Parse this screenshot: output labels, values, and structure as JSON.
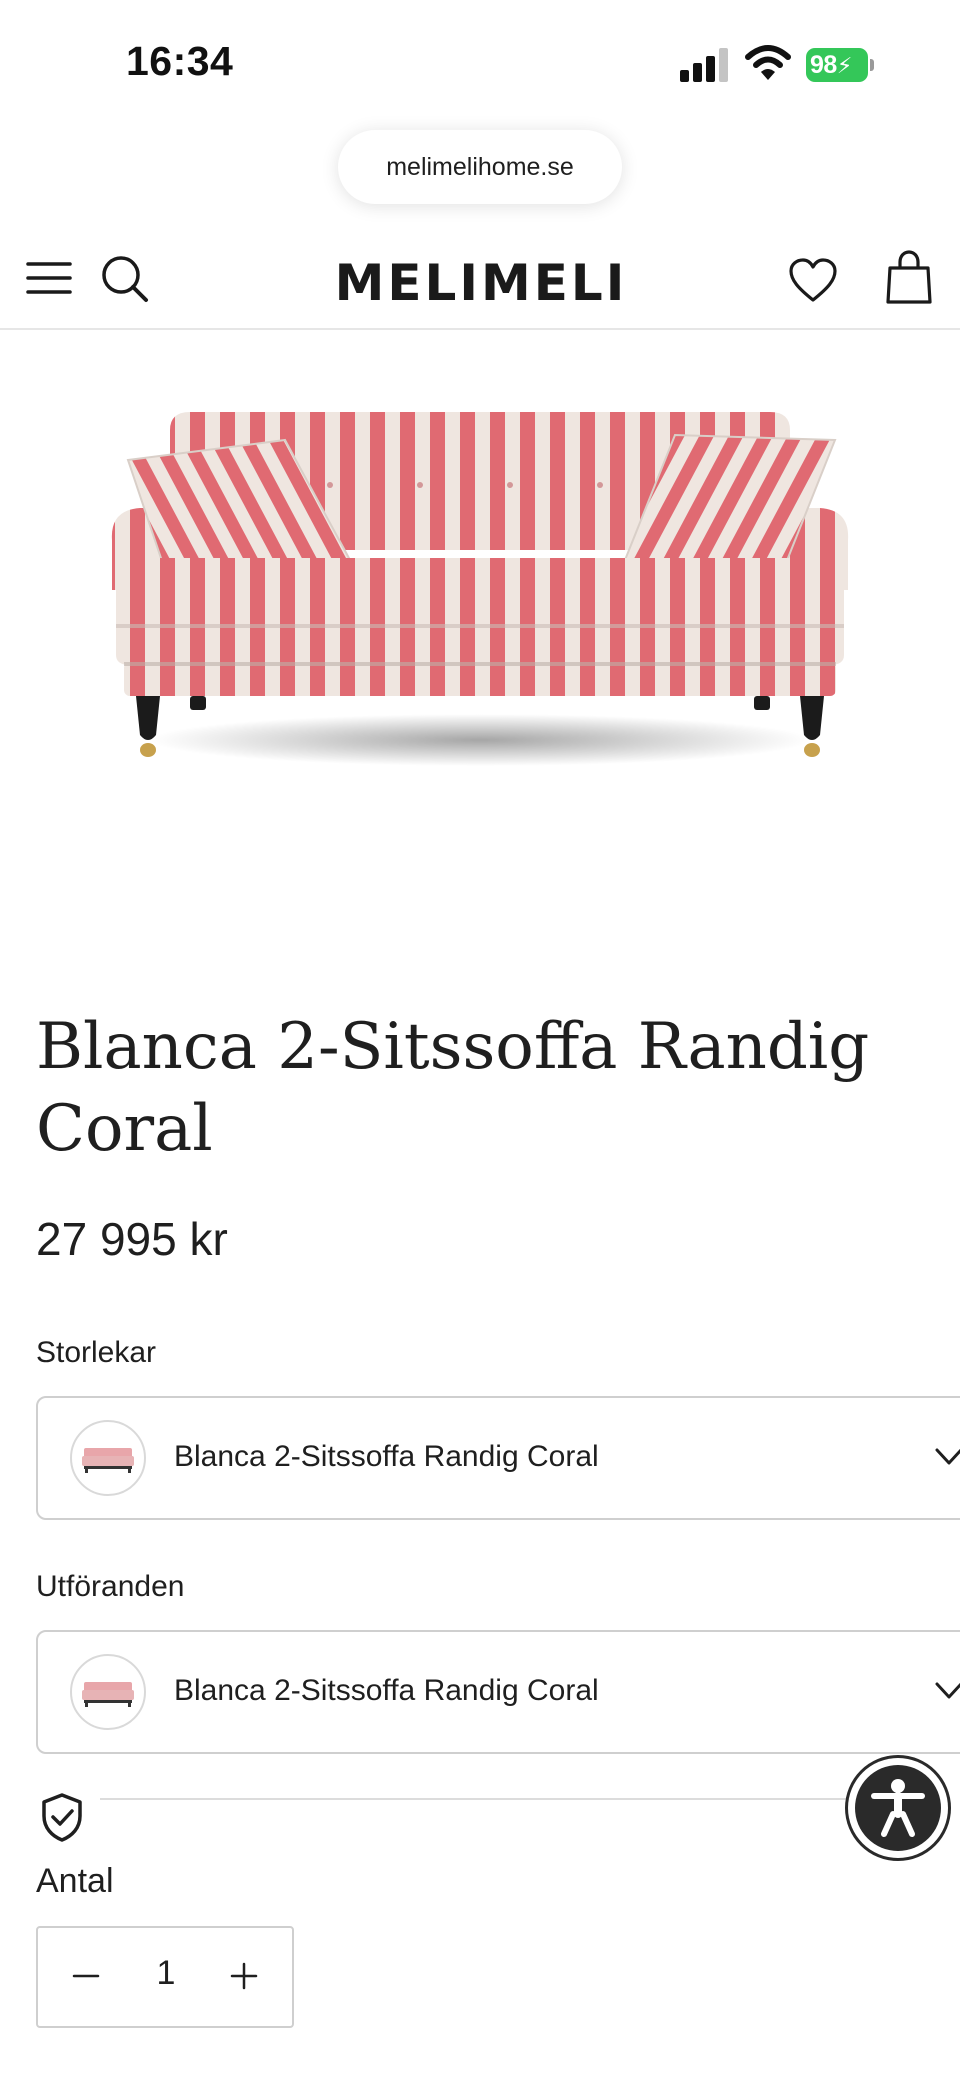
{
  "status_bar": {
    "time": "16:34",
    "battery_level": "98",
    "battery_color": "#34c759",
    "icons": [
      "cellular-signal-icon",
      "wifi-icon",
      "battery-charging-icon"
    ]
  },
  "browser": {
    "url": "melimelihome.se"
  },
  "header": {
    "logo": "MELIMELI",
    "icons": [
      "menu-icon",
      "search-icon",
      "heart-icon",
      "shopping-bag-icon"
    ]
  },
  "product": {
    "image_subject": "sofa",
    "title": "Blanca 2-Sitssoffa Randig Coral",
    "price": "27 995 kr",
    "stripe_color": "#e06a72"
  },
  "options": {
    "sizes_label": "Storlekar",
    "sizes_value": "Blanca 2-Sitssoffa Randig Coral",
    "variants_label": "Utföranden",
    "variants_value": "Blanca 2-Sitssoffa Randig Coral"
  },
  "quantity": {
    "label": "Antal",
    "value": "1"
  },
  "accessibility": {
    "icon": "accessibility-icon"
  }
}
